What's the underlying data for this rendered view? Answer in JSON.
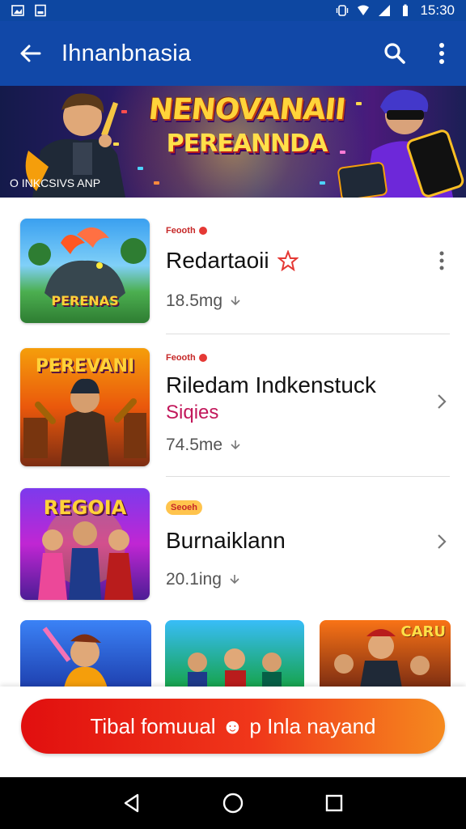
{
  "status_bar": {
    "time": "15:30"
  },
  "app_bar": {
    "title": "Ihnanbnasia"
  },
  "banner": {
    "title": "NENOVANAII",
    "subtitle": "PEREANNDA",
    "caption": "O INKCSIVS ANP"
  },
  "items": [
    {
      "tag": "Feooth",
      "name": "Redartaoii",
      "meta": "18.5mg",
      "thumb_text": "PERENAS"
    },
    {
      "tag": "Feooth",
      "name": "Riledam Indkenstuck",
      "subtitle": "Siqies",
      "meta": "74.5me",
      "thumb_text": "PEREVANI"
    },
    {
      "tag": "Seoeh",
      "name": "Burnaiklann",
      "meta": "20.1ing",
      "thumb_text": "REGOIA"
    }
  ],
  "bottom_tiles": [
    {
      "label": ""
    },
    {
      "label": ""
    },
    {
      "label": "CARU"
    }
  ],
  "cta": {
    "label": "Tibal fomuual ☻ p Inla nayand"
  },
  "colors": {
    "app_bar": "#1148a8",
    "status_bar": "#0d47a1",
    "cta_start": "#e10f0f",
    "cta_end": "#f58a1e",
    "accent_red": "#c62828"
  }
}
